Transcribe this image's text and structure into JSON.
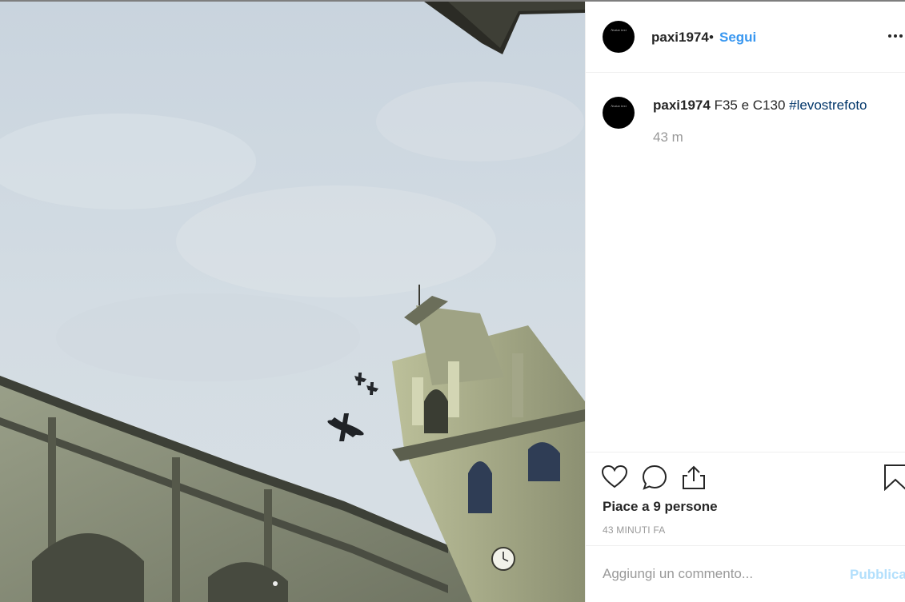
{
  "post": {
    "username": "paxi1974",
    "separator": "•",
    "follow_label": "Segui",
    "avatar_text": "Avatar text",
    "more_icon": "more-horizontal-icon"
  },
  "caption": {
    "username": "paxi1974",
    "text": "F35 e C130",
    "hashtag": "#levostrefoto",
    "time": "43 m"
  },
  "actions": {
    "like_icon": "heart-icon",
    "comment_icon": "comment-bubble-icon",
    "share_icon": "share-upload-icon",
    "save_icon": "bookmark-icon",
    "likes_text": "Piace a 9 persone",
    "timestamp": "43 MINUTI FA"
  },
  "add_comment": {
    "placeholder": "Aggiungi un commento...",
    "post_label": "Pubblica"
  },
  "colors": {
    "accent": "#3897f0",
    "hashtag": "#003569",
    "post_disabled": "#b2dffc",
    "muted": "#999999",
    "text": "#262626"
  },
  "photo": {
    "description_icons": [
      "sky",
      "church-facade",
      "bell-tower",
      "c130-plane",
      "f35-jets"
    ]
  }
}
